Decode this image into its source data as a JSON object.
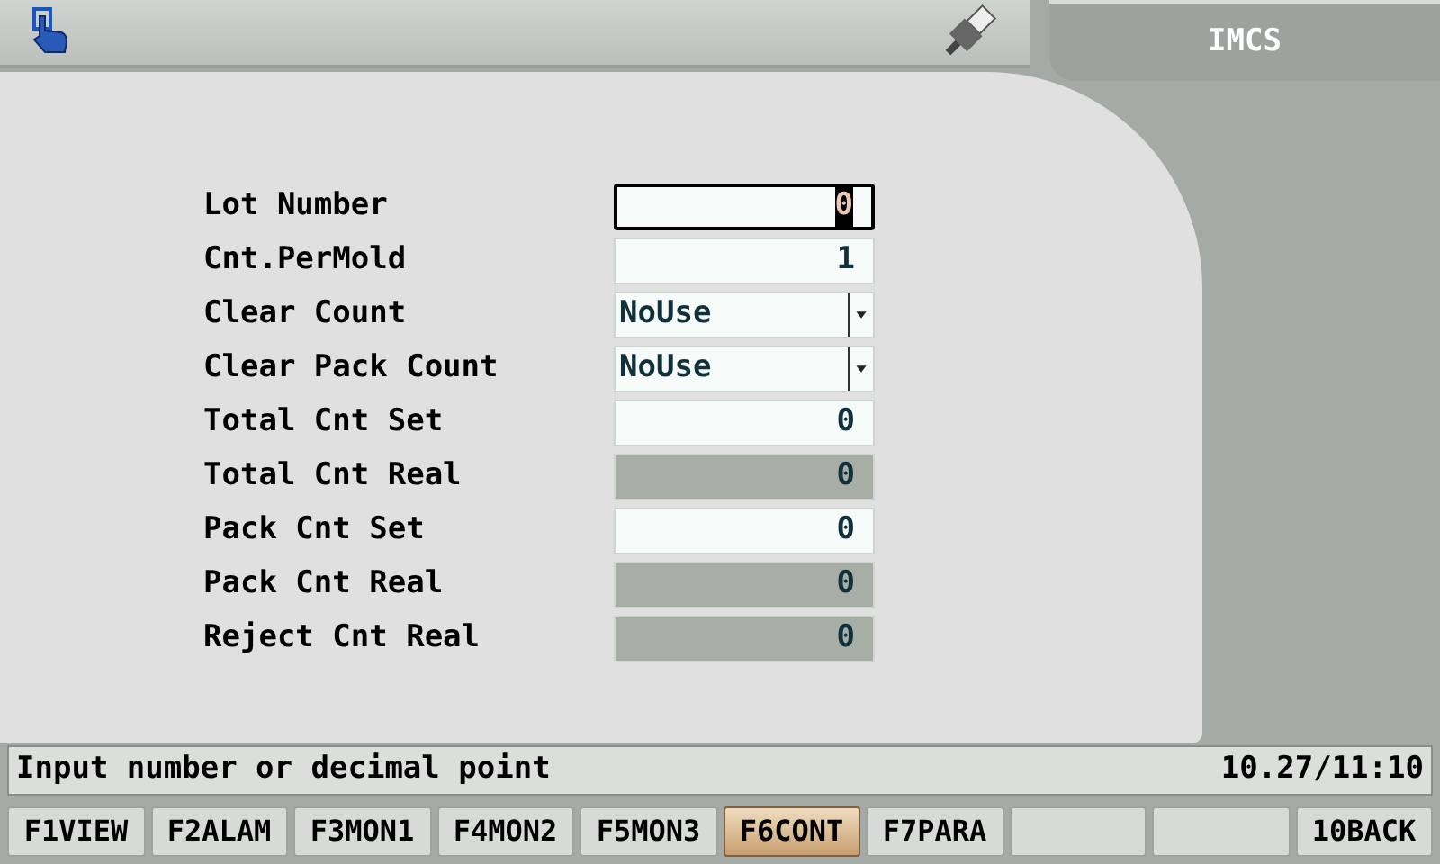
{
  "header": {
    "title": "IMCS"
  },
  "fields": [
    {
      "label": "Lot Number",
      "kind": "input",
      "value": "0",
      "focused": true
    },
    {
      "label": "Cnt.PerMold",
      "kind": "input",
      "value": "1",
      "focused": false
    },
    {
      "label": "Clear Count",
      "kind": "select",
      "value": "NoUse",
      "focused": false
    },
    {
      "label": "Clear Pack Count",
      "kind": "select",
      "value": "NoUse",
      "focused": false
    },
    {
      "label": "Total Cnt Set",
      "kind": "input",
      "value": "0",
      "focused": false
    },
    {
      "label": "Total Cnt Real",
      "kind": "readonly",
      "value": "0",
      "focused": false
    },
    {
      "label": "Pack Cnt Set",
      "kind": "input",
      "value": "0",
      "focused": false
    },
    {
      "label": "Pack Cnt Real",
      "kind": "readonly",
      "value": "0",
      "focused": false
    },
    {
      "label": "Reject Cnt Real",
      "kind": "readonly",
      "value": "0",
      "focused": false
    }
  ],
  "status_bar": {
    "message": "Input number or decimal point",
    "datetime": "10.27/11:10"
  },
  "function_keys": [
    {
      "kind": "key",
      "label": "F1VIEW",
      "selected": false
    },
    {
      "kind": "key",
      "label": "F2ALAM",
      "selected": false
    },
    {
      "kind": "key",
      "label": "F3MON1",
      "selected": false
    },
    {
      "kind": "key",
      "label": "F4MON2",
      "selected": false
    },
    {
      "kind": "key",
      "label": "F5MON3",
      "selected": false
    },
    {
      "kind": "key",
      "label": "F6CONT",
      "selected": true
    },
    {
      "kind": "key",
      "label": "F7PARA",
      "selected": false
    },
    {
      "kind": "blank",
      "selected": false
    },
    {
      "kind": "blank",
      "selected": false
    },
    {
      "kind": "key",
      "label": "10BACK",
      "selected": false
    }
  ]
}
